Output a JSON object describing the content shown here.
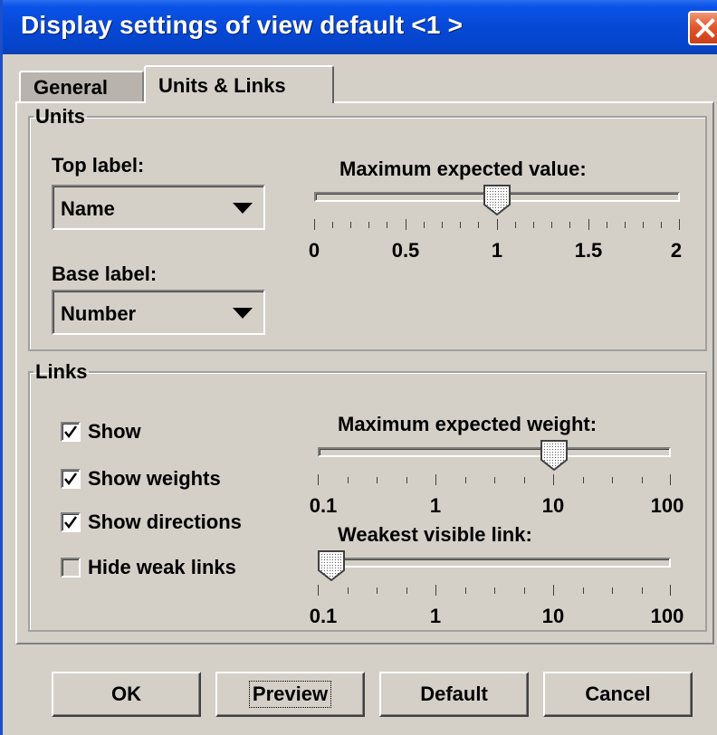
{
  "window": {
    "title": "Display settings of view default <1 >"
  },
  "tabs": [
    {
      "label": "General",
      "selected": false
    },
    {
      "label": "Units & Links",
      "selected": true
    }
  ],
  "units": {
    "legend": "Units",
    "top_label": {
      "label": "Top label:",
      "value": "Name"
    },
    "base_label": {
      "label": "Base label:",
      "value": "Number"
    },
    "max_value": {
      "label": "Maximum expected value:",
      "tick_labels": [
        "0",
        "0.5",
        "1",
        "1.5",
        "2"
      ],
      "value": 1,
      "min": 0,
      "max": 2
    }
  },
  "links": {
    "legend": "Links",
    "checkboxes": [
      {
        "label": "Show",
        "checked": true
      },
      {
        "label": "Show weights",
        "checked": true
      },
      {
        "label": "Show directions",
        "checked": true
      },
      {
        "label": "Hide weak links",
        "checked": false
      }
    ],
    "max_weight": {
      "label": "Maximum expected weight:",
      "tick_labels": [
        "0.1",
        "1",
        "10",
        "100"
      ],
      "value": 10,
      "scale": "log"
    },
    "weakest_link": {
      "label": "Weakest visible link:",
      "tick_labels": [
        "0.1",
        "1",
        "10",
        "100"
      ],
      "value": 0.1,
      "scale": "log"
    }
  },
  "buttons": {
    "ok": "OK",
    "preview": "Preview",
    "default": "Default",
    "cancel": "Cancel"
  },
  "colors": {
    "titlebar": "#0648d6",
    "close": "#e4572e",
    "dialog": "#d4d0c8"
  }
}
